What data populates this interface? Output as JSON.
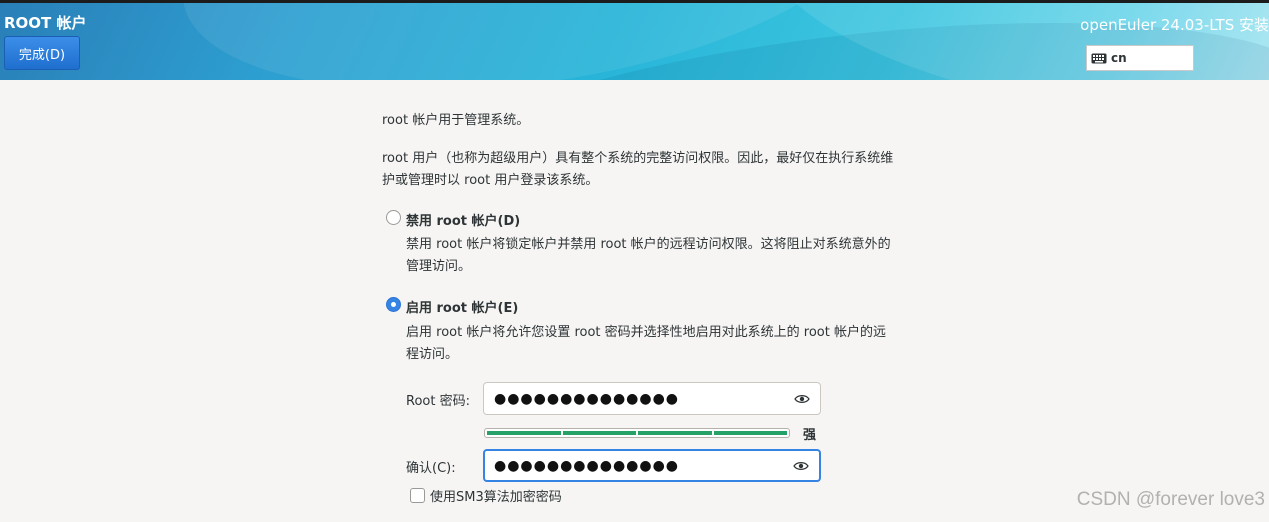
{
  "header": {
    "title": "ROOT 帐户",
    "done_button": "完成(D)",
    "product": "openEuler 24.03-LTS 安装",
    "keyboard_layout": "cn",
    "keyboard_icon": "keyboard-icon"
  },
  "content": {
    "intro": "root 帐户用于管理系统。",
    "description_line1": "root 用户（也称为超级用户）具有整个系统的完整访问权限。因此，最好仅在执行系统维",
    "description_line2": "护或管理时以 root 用户登录该系统。",
    "options": [
      {
        "label": "禁用 root 帐户(D)",
        "selected": false,
        "desc_line1": "禁用 root 帐户将锁定帐户并禁用 root 帐户的远程访问权限。这将阻止对系统意外的",
        "desc_line2": "管理访问。"
      },
      {
        "label": "启用 root 帐户(E)",
        "selected": true,
        "desc_line1": "启用 root 帐户将允许您设置 root 密码并选择性地启用对此系统上的 root 帐户的远",
        "desc_line2": "程访问。"
      }
    ],
    "password": {
      "label": "Root 密码:",
      "value": "●●●●●●●●●●●●●●",
      "reveal_icon": "eye-icon"
    },
    "strength": {
      "level_fraction": 1.0,
      "text": "强",
      "color": "#26a269"
    },
    "confirm": {
      "label": "确认(C):",
      "value": "●●●●●●●●●●●●●●",
      "reveal_icon": "eye-icon"
    },
    "sm3_checkbox": {
      "label": "使用SM3算法加密密码",
      "checked": false
    }
  },
  "watermark": "CSDN @forever love3"
}
